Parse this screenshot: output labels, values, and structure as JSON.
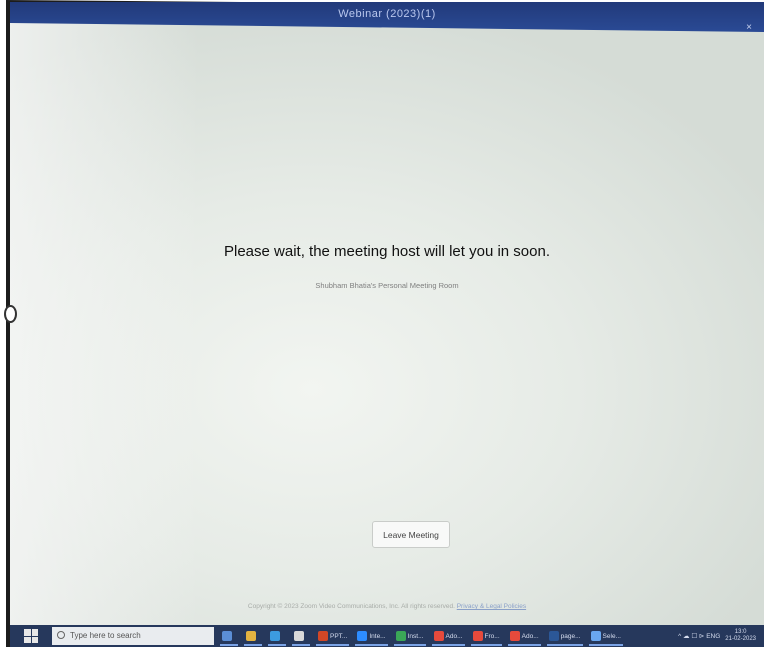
{
  "window": {
    "title": "Webinar (2023)(1)",
    "close_glyph": "×"
  },
  "waiting": {
    "message": "Please wait, the meeting host will let you in soon.",
    "room": "Shubham Bhatia's Personal Meeting Room"
  },
  "actions": {
    "leave_label": "Leave Meeting"
  },
  "footer": {
    "copyright": "Copyright © 2023 Zoom Video Communications, Inc. All rights reserved.",
    "policy_link": "Privacy & Legal Policies"
  },
  "taskbar": {
    "search_placeholder": "Type here to search",
    "apps": [
      {
        "name": "task-view",
        "label": "",
        "color": "#5b8ed6"
      },
      {
        "name": "file-explorer",
        "label": "",
        "color": "#e3b341"
      },
      {
        "name": "edge",
        "label": "",
        "color": "#3c9be0"
      },
      {
        "name": "chrome",
        "label": "",
        "color": "#d9d9d9"
      },
      {
        "name": "ppt",
        "label": "PPT...",
        "color": "#d24726"
      },
      {
        "name": "zoom",
        "label": "Inte...",
        "color": "#2d8cff"
      },
      {
        "name": "chrome-2",
        "label": "Inst...",
        "color": "#3aa757"
      },
      {
        "name": "acrobat",
        "label": "Ado...",
        "color": "#e64a3c"
      },
      {
        "name": "acrobat-2",
        "label": "Fro...",
        "color": "#e64a3c"
      },
      {
        "name": "acrobat-3",
        "label": "Ado...",
        "color": "#e64a3c"
      },
      {
        "name": "word",
        "label": "page...",
        "color": "#2b5797"
      },
      {
        "name": "zoom-2",
        "label": "Sele...",
        "color": "#6aa7f0"
      }
    ],
    "tray_text": "^ ☁ ☐ ⊳ ENG",
    "time": "13:0",
    "date": "21-02-2023"
  }
}
